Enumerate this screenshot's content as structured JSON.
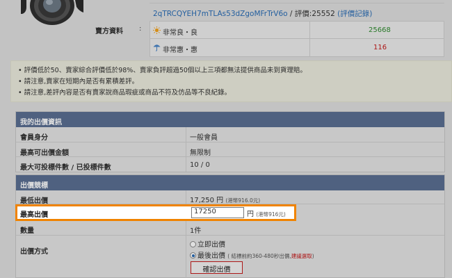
{
  "seller": {
    "section_label": "賣方資料",
    "colon": ":",
    "user_id": "2qTRCQYEH7mTLAs53dZgoMFrTrV6o",
    "rating_prefix": " / 評價:",
    "rating_value": "25552",
    "rating_link": "(評價記錄)",
    "good_label": "非常良・良",
    "good_count": "25668",
    "bad_label": "非常惠・惠",
    "bad_count": "116"
  },
  "notices": [
    "評價低於50、賣家綜合評價低於98%、賣家負評超過50個以上三項都無法提供商品未到貨理賠。",
    "請注意,賣家在短期內是否有累積差評。",
    "請注意,差評內容是否有賣家說商品瑕疵或商品不符及仿品等不良紀錄。"
  ],
  "my_bid": {
    "header": "我的出價資訊",
    "rows": [
      {
        "label": "會員身分",
        "value": "一般會員"
      },
      {
        "label": "最高可出價金額",
        "value": "無限制"
      },
      {
        "label": "最大可投標件數 / 已投標件數",
        "value": "10 / 0"
      }
    ]
  },
  "bid_form": {
    "header": "出價競標",
    "min_bid_label": "最低出價",
    "min_bid_value": "17,250 円",
    "min_bid_hkd": "(港幣916.0元)",
    "max_bid_label": "最高出價",
    "max_bid_input": "17250",
    "max_bid_unit": "円",
    "max_bid_hkd": "(港幣916元)",
    "qty_label": "數量",
    "qty_value": "1件",
    "method_label": "出價方式",
    "option_now": "立即出價",
    "option_last": "最後出價",
    "option_last_note": "( 結標前約360-480秒出價,",
    "option_last_recommend": "建議選取",
    "option_last_close": ")",
    "confirm_button": "確認出價"
  },
  "icons": {
    "good": "sun-icon",
    "bad": "umbrella-icon",
    "photo": "camera-photo"
  },
  "colors": {
    "header_bg": "#5a6f92",
    "link": "#2a6db5",
    "good": "#2f8a2f",
    "bad": "#c41a1a",
    "focus": "#f08300"
  }
}
